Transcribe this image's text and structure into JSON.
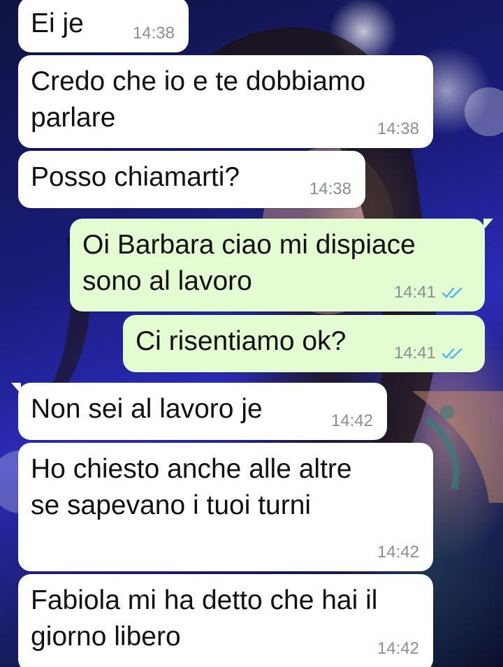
{
  "conversation": {
    "messages": [
      {
        "direction": "in",
        "text": "Ei je",
        "time": "14:38"
      },
      {
        "direction": "in",
        "text": "Credo che io e te dobbiamo\nparlare",
        "time": "14:38"
      },
      {
        "direction": "in",
        "text": "Posso chiamarti?",
        "time": "14:38"
      },
      {
        "direction": "out",
        "text": "Oi Barbara ciao mi dispiace\nsono al lavoro",
        "time": "14:41",
        "status": "read"
      },
      {
        "direction": "out",
        "text": "Ci risentiamo ok?",
        "time": "14:41",
        "status": "read"
      },
      {
        "direction": "in",
        "text": "Non sei al lavoro je",
        "time": "14:42"
      },
      {
        "direction": "in",
        "text": "Ho chiesto anche alle altre\nse sapevano i tuoi turni",
        "time": "14:42"
      },
      {
        "direction": "in",
        "text": "Fabiola mi ha detto che hai il\ngiorno libero",
        "time": "14:42"
      }
    ]
  },
  "colors": {
    "incoming_bubble": "#ffffff",
    "outgoing_bubble": "#e3fcd2",
    "timestamp": "#8a8f93",
    "read_ticks": "#4fb6ec"
  },
  "icons": {
    "read_status": "double-check-icon"
  }
}
